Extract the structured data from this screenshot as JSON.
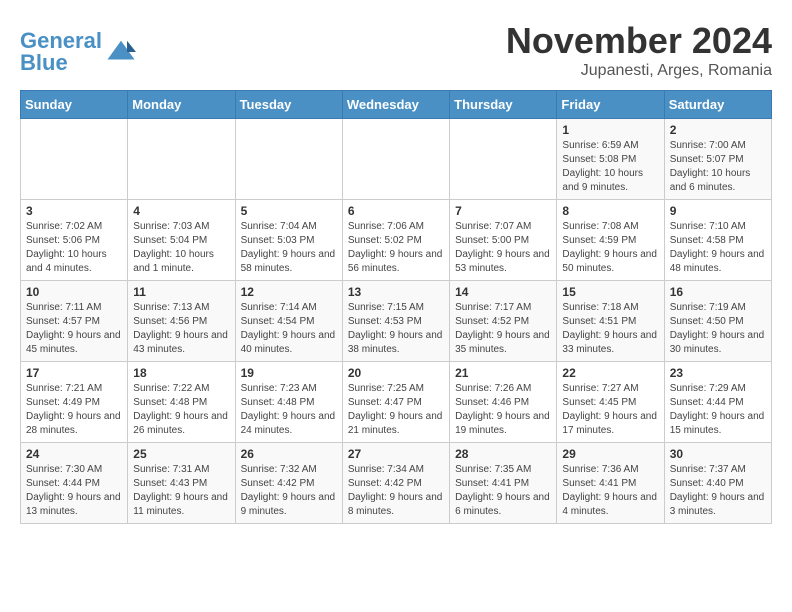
{
  "logo": {
    "text_general": "General",
    "text_blue": "Blue"
  },
  "header": {
    "month": "November 2024",
    "location": "Jupanesti, Arges, Romania"
  },
  "weekdays": [
    "Sunday",
    "Monday",
    "Tuesday",
    "Wednesday",
    "Thursday",
    "Friday",
    "Saturday"
  ],
  "weeks": [
    [
      {
        "day": "",
        "detail": ""
      },
      {
        "day": "",
        "detail": ""
      },
      {
        "day": "",
        "detail": ""
      },
      {
        "day": "",
        "detail": ""
      },
      {
        "day": "",
        "detail": ""
      },
      {
        "day": "1",
        "detail": "Sunrise: 6:59 AM\nSunset: 5:08 PM\nDaylight: 10 hours and 9 minutes."
      },
      {
        "day": "2",
        "detail": "Sunrise: 7:00 AM\nSunset: 5:07 PM\nDaylight: 10 hours and 6 minutes."
      }
    ],
    [
      {
        "day": "3",
        "detail": "Sunrise: 7:02 AM\nSunset: 5:06 PM\nDaylight: 10 hours and 4 minutes."
      },
      {
        "day": "4",
        "detail": "Sunrise: 7:03 AM\nSunset: 5:04 PM\nDaylight: 10 hours and 1 minute."
      },
      {
        "day": "5",
        "detail": "Sunrise: 7:04 AM\nSunset: 5:03 PM\nDaylight: 9 hours and 58 minutes."
      },
      {
        "day": "6",
        "detail": "Sunrise: 7:06 AM\nSunset: 5:02 PM\nDaylight: 9 hours and 56 minutes."
      },
      {
        "day": "7",
        "detail": "Sunrise: 7:07 AM\nSunset: 5:00 PM\nDaylight: 9 hours and 53 minutes."
      },
      {
        "day": "8",
        "detail": "Sunrise: 7:08 AM\nSunset: 4:59 PM\nDaylight: 9 hours and 50 minutes."
      },
      {
        "day": "9",
        "detail": "Sunrise: 7:10 AM\nSunset: 4:58 PM\nDaylight: 9 hours and 48 minutes."
      }
    ],
    [
      {
        "day": "10",
        "detail": "Sunrise: 7:11 AM\nSunset: 4:57 PM\nDaylight: 9 hours and 45 minutes."
      },
      {
        "day": "11",
        "detail": "Sunrise: 7:13 AM\nSunset: 4:56 PM\nDaylight: 9 hours and 43 minutes."
      },
      {
        "day": "12",
        "detail": "Sunrise: 7:14 AM\nSunset: 4:54 PM\nDaylight: 9 hours and 40 minutes."
      },
      {
        "day": "13",
        "detail": "Sunrise: 7:15 AM\nSunset: 4:53 PM\nDaylight: 9 hours and 38 minutes."
      },
      {
        "day": "14",
        "detail": "Sunrise: 7:17 AM\nSunset: 4:52 PM\nDaylight: 9 hours and 35 minutes."
      },
      {
        "day": "15",
        "detail": "Sunrise: 7:18 AM\nSunset: 4:51 PM\nDaylight: 9 hours and 33 minutes."
      },
      {
        "day": "16",
        "detail": "Sunrise: 7:19 AM\nSunset: 4:50 PM\nDaylight: 9 hours and 30 minutes."
      }
    ],
    [
      {
        "day": "17",
        "detail": "Sunrise: 7:21 AM\nSunset: 4:49 PM\nDaylight: 9 hours and 28 minutes."
      },
      {
        "day": "18",
        "detail": "Sunrise: 7:22 AM\nSunset: 4:48 PM\nDaylight: 9 hours and 26 minutes."
      },
      {
        "day": "19",
        "detail": "Sunrise: 7:23 AM\nSunset: 4:48 PM\nDaylight: 9 hours and 24 minutes."
      },
      {
        "day": "20",
        "detail": "Sunrise: 7:25 AM\nSunset: 4:47 PM\nDaylight: 9 hours and 21 minutes."
      },
      {
        "day": "21",
        "detail": "Sunrise: 7:26 AM\nSunset: 4:46 PM\nDaylight: 9 hours and 19 minutes."
      },
      {
        "day": "22",
        "detail": "Sunrise: 7:27 AM\nSunset: 4:45 PM\nDaylight: 9 hours and 17 minutes."
      },
      {
        "day": "23",
        "detail": "Sunrise: 7:29 AM\nSunset: 4:44 PM\nDaylight: 9 hours and 15 minutes."
      }
    ],
    [
      {
        "day": "24",
        "detail": "Sunrise: 7:30 AM\nSunset: 4:44 PM\nDaylight: 9 hours and 13 minutes."
      },
      {
        "day": "25",
        "detail": "Sunrise: 7:31 AM\nSunset: 4:43 PM\nDaylight: 9 hours and 11 minutes."
      },
      {
        "day": "26",
        "detail": "Sunrise: 7:32 AM\nSunset: 4:42 PM\nDaylight: 9 hours and 9 minutes."
      },
      {
        "day": "27",
        "detail": "Sunrise: 7:34 AM\nSunset: 4:42 PM\nDaylight: 9 hours and 8 minutes."
      },
      {
        "day": "28",
        "detail": "Sunrise: 7:35 AM\nSunset: 4:41 PM\nDaylight: 9 hours and 6 minutes."
      },
      {
        "day": "29",
        "detail": "Sunrise: 7:36 AM\nSunset: 4:41 PM\nDaylight: 9 hours and 4 minutes."
      },
      {
        "day": "30",
        "detail": "Sunrise: 7:37 AM\nSunset: 4:40 PM\nDaylight: 9 hours and 3 minutes."
      }
    ]
  ]
}
